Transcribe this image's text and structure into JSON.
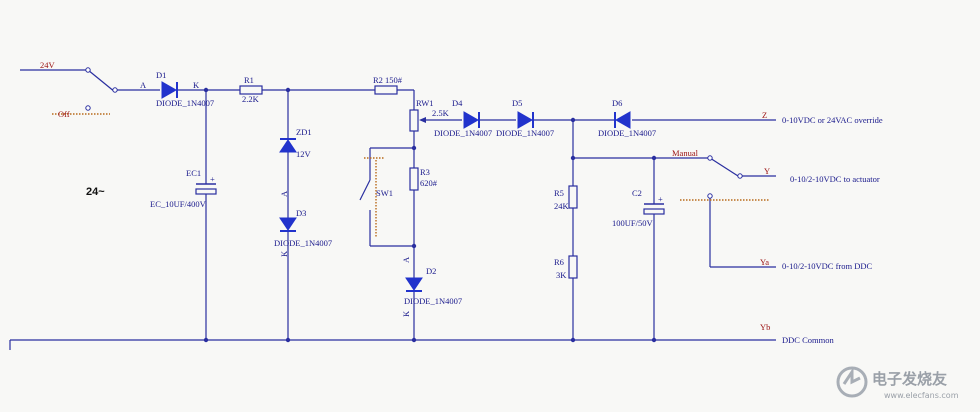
{
  "sources": {
    "v24": "24V",
    "off": "Off",
    "ac_label": "24~"
  },
  "d1": {
    "ref": "D1",
    "value": "DIODE_1N4007",
    "anode": "A",
    "cathode": "K"
  },
  "r1": {
    "ref": "R1",
    "value": "2.2K"
  },
  "r2": {
    "ref": "R2",
    "value": "150#"
  },
  "zd1": {
    "ref": "ZD1",
    "value": "12V",
    "anode": "A"
  },
  "d3": {
    "ref": "D3",
    "value": "DIODE_1N4007",
    "cathode": "K"
  },
  "ec1": {
    "ref": "EC1",
    "value": "EC_10UF/400V"
  },
  "rw1": {
    "ref": "RW1",
    "value": "2.5K"
  },
  "r3": {
    "ref": "R3",
    "value": "620#"
  },
  "sw1": {
    "ref": "SW1"
  },
  "d2": {
    "ref": "D2",
    "value": "DIODE_1N4007",
    "anode": "A",
    "cathode": "K"
  },
  "d4": {
    "ref": "D4",
    "value": "DIODE_1N4007"
  },
  "d5": {
    "ref": "D5",
    "value": "DIODE_1N4007"
  },
  "d6": {
    "ref": "D6",
    "value": "DIODE_1N4007"
  },
  "r5": {
    "ref": "R5",
    "value": "24K"
  },
  "r6": {
    "ref": "R6",
    "value": "3K"
  },
  "c2": {
    "ref": "C2",
    "value": "100UF/50V"
  },
  "manual": "Manual",
  "outputs": {
    "z": {
      "pin": "Z",
      "desc": "0-10VDC or 24VAC override"
    },
    "y": {
      "pin": "Y",
      "desc": "0-10/2-10VDC to actuator"
    },
    "ya": {
      "pin": "Ya",
      "desc": "0-10/2-10VDC from DDC"
    },
    "yb": {
      "pin": "Yb",
      "desc": "DDC Common"
    }
  },
  "watermark": {
    "name": "电子发烧友",
    "url": "www.elecfans.com"
  }
}
